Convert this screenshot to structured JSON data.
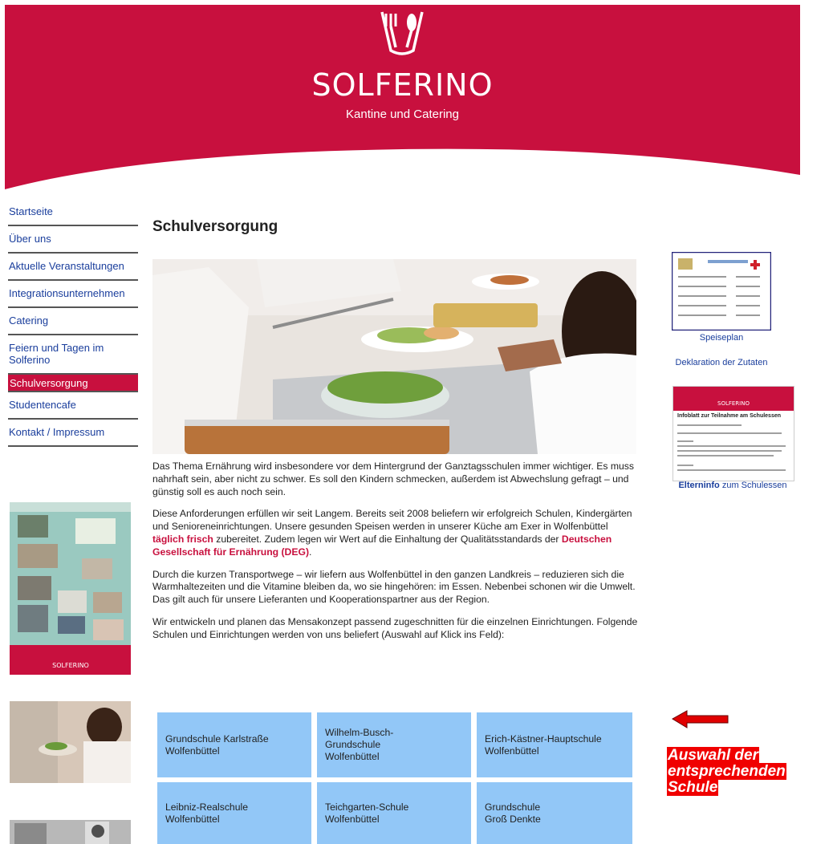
{
  "brand": {
    "name": "SOLFERINO",
    "tagline": "Kantine und Catering",
    "color": "#c8103e"
  },
  "nav": {
    "items": [
      {
        "label": "Startseite"
      },
      {
        "label": "Über uns"
      },
      {
        "label": "Aktuelle Veranstaltungen"
      },
      {
        "label": "Integrationsunternehmen"
      },
      {
        "label": "Catering"
      },
      {
        "label": "Feiern und Tagen im Solferino"
      },
      {
        "label": "Schulversorgung",
        "active": true
      },
      {
        "label": "Studentencafe"
      },
      {
        "label": "Kontakt / Impressum"
      }
    ]
  },
  "main": {
    "title": "Schulversorgung",
    "paragraphs": {
      "p1": "Das Thema Ernährung wird insbesondere vor dem Hintergrund der Ganztagsschulen immer wichtiger. Es muss nahrhaft sein, aber nicht zu schwer. Es soll den Kindern schmecken, außerdem ist Abwechslung gefragt – und günstig soll es auch noch sein.",
      "p2_a": "Diese Anforderungen erfüllen wir seit Langem. Bereits seit 2008 beliefern wir erfolgreich Schulen, Kindergärten und Senioreneinrichtungen. Unsere gesunden Speisen werden in unserer Küche am Exer in Wolfenbüttel ",
      "p2_hl1": "täglich frisch",
      "p2_b": " zubereitet. Zudem legen wir Wert auf die Einhaltung der Qualitätsstandards der ",
      "p2_hl2": "Deutschen Gesellschaft für Ernährung (DEG)",
      "p2_c": ".",
      "p3": "Durch die kurzen Transportwege – wir liefern aus Wolfenbüttel in den ganzen Landkreis – reduzieren sich die Warmhaltezeiten und die Vitamine bleiben da, wo sie hingehören: im Essen. Nebenbei schonen wir die Umwelt. Das gilt auch für unsere Lieferanten und Kooperationspartner aus der Region.",
      "p4": "Wir entwickeln und planen das Mensakonzept passend zugeschnitten für die einzelnen Einrichtungen. Folgende Schulen und Einrichtungen werden von uns beliefert (Auswahl auf Klick ins Feld):"
    },
    "schools": [
      {
        "line1": "Grundschule Karlstraße",
        "line2": "Wolfenbüttel",
        "line3": ""
      },
      {
        "line1": "Wilhelm-Busch-",
        "line2": "Grundschule",
        "line3": "Wolfenbüttel"
      },
      {
        "line1": "Erich-Kästner-Hauptschule",
        "line2": "Wolfenbüttel",
        "line3": ""
      },
      {
        "line1": "Leibniz-Realschule",
        "line2": "Wolfenbüttel",
        "line3": ""
      },
      {
        "line1": "Teichgarten-Schule",
        "line2": "Wolfenbüttel",
        "line3": ""
      },
      {
        "line1": "Grundschule",
        "line2": "Groß Denkte",
        "line3": ""
      }
    ]
  },
  "right": {
    "speiseplan_label": "Speiseplan",
    "deklaration_label": "Deklaration der Zutaten",
    "elterninfo_bold": "Elterninfo",
    "elterninfo_rest": " zum Schulessen",
    "infoblatt_title": "Infoblatt zur Teilnahme am Schulessen"
  },
  "annotation": {
    "line1": "Auswahl der",
    "line2": "entsprechenden",
    "line3": "Schule",
    "color": "#f00000"
  }
}
